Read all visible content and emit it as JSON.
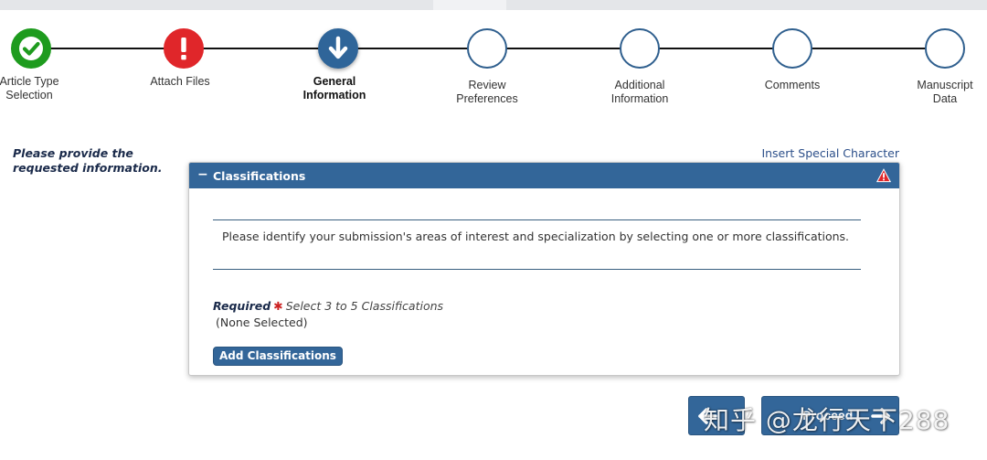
{
  "stepper": {
    "steps": [
      {
        "label_line1": "Article Type",
        "label_line2": "Selection",
        "status": "complete",
        "icon": "check-icon",
        "color": "#1e9b1e"
      },
      {
        "label_line1": "Attach Files",
        "label_line2": "",
        "status": "error",
        "icon": "exclamation-icon",
        "color": "#e0262a"
      },
      {
        "label_line1": "General",
        "label_line2": "Information",
        "status": "current",
        "icon": "arrow-down-icon",
        "color": "#2f6599"
      },
      {
        "label_line1": "Review",
        "label_line2": "Preferences",
        "status": "pending",
        "icon": "empty-circle-icon",
        "color": "#2f5f8e"
      },
      {
        "label_line1": "Additional",
        "label_line2": "Information",
        "status": "pending",
        "icon": "empty-circle-icon",
        "color": "#2f5f8e"
      },
      {
        "label_line1": "Comments",
        "label_line2": "",
        "status": "pending",
        "icon": "empty-circle-icon",
        "color": "#2f5f8e"
      },
      {
        "label_line1": "Manuscript",
        "label_line2": "Data",
        "status": "pending",
        "icon": "empty-circle-icon",
        "color": "#2f5f8e"
      }
    ]
  },
  "intro": {
    "line1": "Please provide the",
    "line2": "requested information."
  },
  "special_char_link": "Insert Special Character",
  "panel": {
    "collapse_symbol": "−",
    "title": "Classifications",
    "warning_icon": "warning-triangle-icon",
    "instruction": "Please identify your submission's areas of interest and specialization by selecting one or more classifications.",
    "required_label": "Required",
    "required_marker": "✱",
    "required_hint": "Select 3 to 5 Classifications",
    "selection_status": "(None Selected)",
    "add_button": "Add Classifications"
  },
  "nav": {
    "back_icon": "arrow-left-icon",
    "next_icon": "arrow-right-icon",
    "next_label": "Proceed"
  },
  "watermark": "知乎 @龙行天下288",
  "colors": {
    "accent": "#336699",
    "complete": "#1e9b1e",
    "error": "#e0262a",
    "required": "#cc2222"
  }
}
